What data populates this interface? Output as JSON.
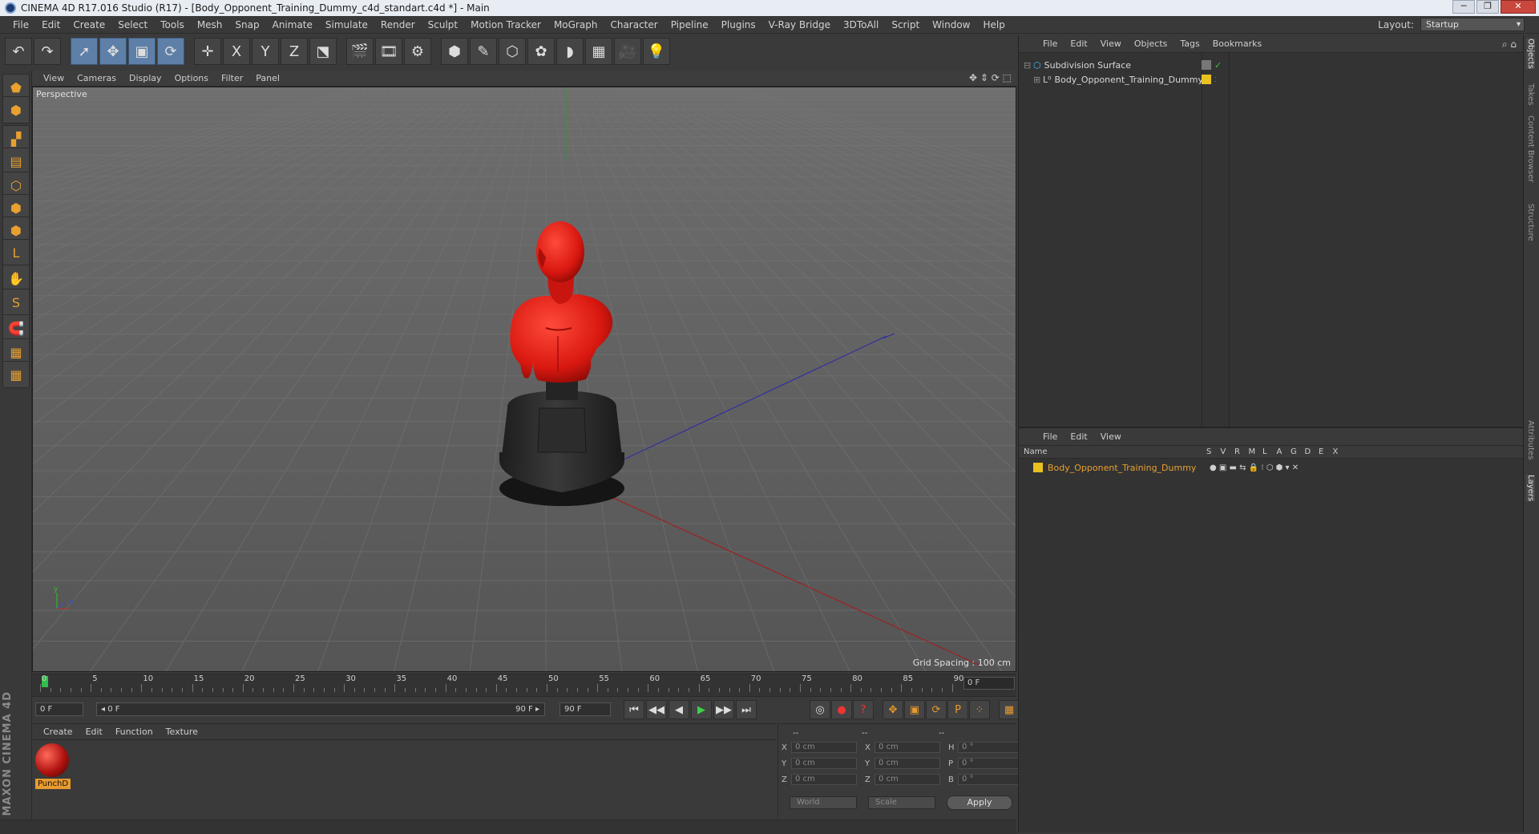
{
  "window": {
    "title": "CINEMA 4D R17.016 Studio (R17) - [Body_Opponent_Training_Dummy_c4d_standart.c4d *] - Main",
    "controls": [
      "─",
      "❐",
      "✕"
    ]
  },
  "menubar": {
    "items": [
      "File",
      "Edit",
      "Create",
      "Select",
      "Tools",
      "Mesh",
      "Snap",
      "Animate",
      "Simulate",
      "Render",
      "Sculpt",
      "Motion Tracker",
      "MoGraph",
      "Character",
      "Pipeline",
      "Plugins",
      "V-Ray Bridge",
      "3DToAll",
      "Script",
      "Window",
      "Help"
    ],
    "layout_label": "Layout:",
    "layout_value": "Startup"
  },
  "toolbar": {
    "icons": [
      "undo-icon",
      "redo-icon",
      "select-arrow-icon",
      "move-icon",
      "scale-icon",
      "rotate-icon",
      "axis-icon",
      "x-lock-icon",
      "y-lock-icon",
      "z-lock-icon",
      "coordinate-system-icon",
      "render-view-icon",
      "render-pv-icon",
      "render-settings-icon",
      "cube-icon",
      "pen-icon",
      "subdivision-icon",
      "cloner-icon",
      "deformer-icon",
      "floor-icon",
      "camera-icon",
      "light-icon"
    ],
    "glyphs": [
      "↶",
      "↷",
      "➚",
      "✥",
      "▣",
      "⟳",
      "✛",
      "X",
      "Y",
      "Z",
      "⬔",
      "🎬",
      "🎞",
      "⚙",
      "⬢",
      "✎",
      "⬡",
      "✿",
      "◗",
      "▦",
      "🎥",
      "💡"
    ]
  },
  "left_tools": {
    "icons": [
      "make-editable-icon",
      "model-mode-icon",
      "texture-mode-icon",
      "workplane-icon",
      "points-mode-icon",
      "edges-mode-icon",
      "polygons-mode-icon",
      "axis-mode-icon",
      "tweak-icon",
      "snap-icon",
      "magnet-icon",
      "lock-workplane-icon",
      "grid-snap-icon"
    ],
    "glyphs": [
      "⬟",
      "⬢",
      "▞",
      "▤",
      "⬡",
      "⬢",
      "⬢",
      "L",
      "✋",
      "S",
      "🧲",
      "▦",
      "▦"
    ],
    "brand": "MAXON CINEMA 4D"
  },
  "viewport": {
    "menu": [
      "View",
      "Cameras",
      "Display",
      "Options",
      "Filter",
      "Panel"
    ],
    "nav_icons": "✥ ⇕ ⟳ ⬚",
    "camera_label": "Perspective",
    "grid_spacing": "Grid Spacing : 100 cm"
  },
  "timeline": {
    "ticks": [
      "0",
      "5",
      "10",
      "15",
      "20",
      "25",
      "30",
      "35",
      "40",
      "45",
      "50",
      "55",
      "60",
      "65",
      "70",
      "75",
      "80",
      "85",
      "90"
    ],
    "current_frame_field": "0 F"
  },
  "transport": {
    "start_field": "0 F",
    "range_start": "◂ 0 F",
    "range_end": "90 F ▸",
    "end_field": "90 F",
    "buttons": [
      "⏮",
      "◀◀",
      "◀",
      "▶",
      "▶▶",
      "⏭"
    ],
    "extra": [
      "◎",
      "●",
      "?",
      "✥",
      "▣",
      "⟳",
      "P",
      "⁘",
      "▦"
    ]
  },
  "material_manager": {
    "menu": [
      "Create",
      "Edit",
      "Function",
      "Texture"
    ],
    "material_name": "PunchD"
  },
  "coordinates": {
    "header": [
      "--",
      "--",
      "--"
    ],
    "rows": [
      {
        "a": "X",
        "av": "0 cm",
        "b": "X",
        "bv": "0 cm",
        "c": "H",
        "cv": "0 °"
      },
      {
        "a": "Y",
        "av": "0 cm",
        "b": "Y",
        "bv": "0 cm",
        "c": "P",
        "cv": "0 °"
      },
      {
        "a": "Z",
        "av": "0 cm",
        "b": "Z",
        "bv": "0 cm",
        "c": "B",
        "cv": "0 °"
      }
    ],
    "space_dropdown": "World",
    "mode_dropdown": "Scale",
    "apply_label": "Apply"
  },
  "object_manager": {
    "menu": [
      "File",
      "Edit",
      "View",
      "Objects",
      "Tags",
      "Bookmarks"
    ],
    "objects": [
      {
        "name": "Subdivision Surface",
        "color": "#c8c8c8"
      },
      {
        "name": "Body_Opponent_Training_Dummy",
        "color": "#c8c8c8"
      }
    ]
  },
  "layer_manager": {
    "menu": [
      "File",
      "Edit",
      "View"
    ],
    "columns": [
      "Name",
      "S",
      "V",
      "R",
      "M",
      "L",
      "A",
      "G",
      "D",
      "E",
      "X"
    ],
    "layer_name": "Body_Opponent_Training_Dummy",
    "layer_color": "#e8c020"
  },
  "side_tabs": [
    "Objects",
    "Takes",
    "Content Browser",
    "Structure",
    "Attributes",
    "Layers"
  ],
  "colors": {
    "accent": "#e89a2e",
    "dummy_body": "#e8241c",
    "dummy_base": "#2b2b2b",
    "axis_x": "#c02020",
    "axis_y": "#20c020",
    "axis_z": "#2020c0"
  }
}
